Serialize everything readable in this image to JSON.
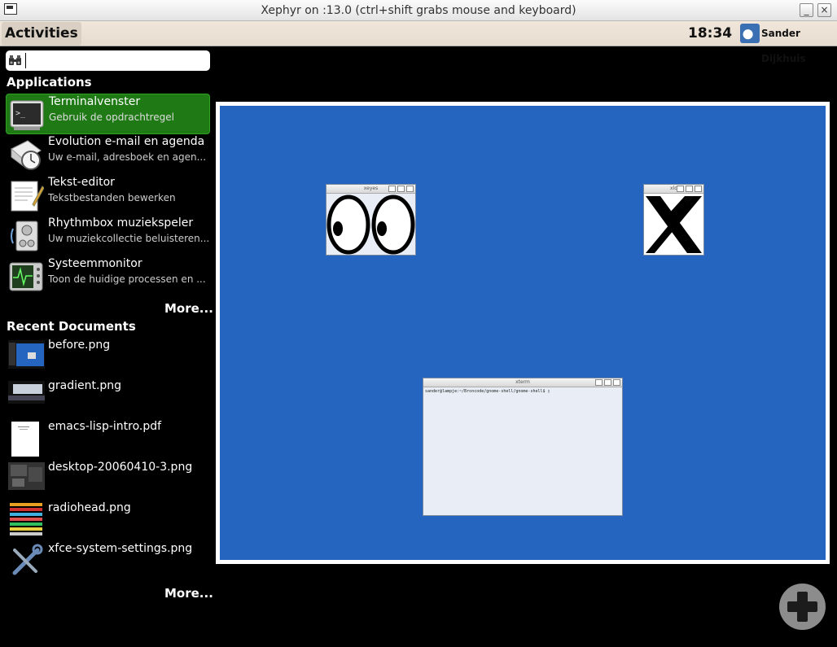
{
  "window": {
    "title": "Xephyr on :13.0 (ctrl+shift grabs mouse and keyboard)",
    "minimize_label": "_",
    "close_label": "×"
  },
  "panel": {
    "activities_label": "Activities",
    "clock": "18:34",
    "user_name": "Sander Dijkhuis"
  },
  "sidebar": {
    "search": {
      "value": "",
      "placeholder": ""
    },
    "applications_header": "Applications",
    "applications": [
      {
        "name": "Terminalvenster",
        "description": "Gebruik de opdrachtregel",
        "icon": "terminal-icon",
        "selected": true
      },
      {
        "name": "Evolution e-mail en agenda",
        "description": "Uw e-mail, adresboek en agen...",
        "icon": "evolution-icon"
      },
      {
        "name": "Tekst-editor",
        "description": "Tekstbestanden bewerken",
        "icon": "text-editor-icon"
      },
      {
        "name": "Rhythmbox muziekspeler",
        "description": "Uw muziekcollectie beluisteren...",
        "icon": "rhythmbox-icon"
      },
      {
        "name": "Systeemmonitor",
        "description": "Toon de huidige processen en ...",
        "icon": "system-monitor-icon"
      }
    ],
    "applications_more": "More...",
    "recent_header": "Recent Documents",
    "documents": [
      {
        "name": "before.png",
        "icon": "image-thumbnail"
      },
      {
        "name": "gradient.png",
        "icon": "image-thumbnail"
      },
      {
        "name": "emacs-lisp-intro.pdf",
        "icon": "pdf-thumbnail"
      },
      {
        "name": "desktop-20060410-3.png",
        "icon": "image-thumbnail"
      },
      {
        "name": "radiohead.png",
        "icon": "image-thumbnail"
      },
      {
        "name": "xfce-system-settings.png",
        "icon": "tools-icon"
      }
    ],
    "documents_more": "More..."
  },
  "workspace": {
    "windows": [
      {
        "title": "xeyes",
        "kind": "xeyes"
      },
      {
        "title": "xlo",
        "kind": "xlogo"
      },
      {
        "title": "xterm",
        "kind": "xterm",
        "prompt": "sander@lampje:~/Broncode/gnome-shell/gnome-shell$ ▯"
      }
    ]
  },
  "colors": {
    "workspace_bg": "#2565bf",
    "selected_item": "#1f7a16",
    "panel_bg": "#f0e6da"
  }
}
